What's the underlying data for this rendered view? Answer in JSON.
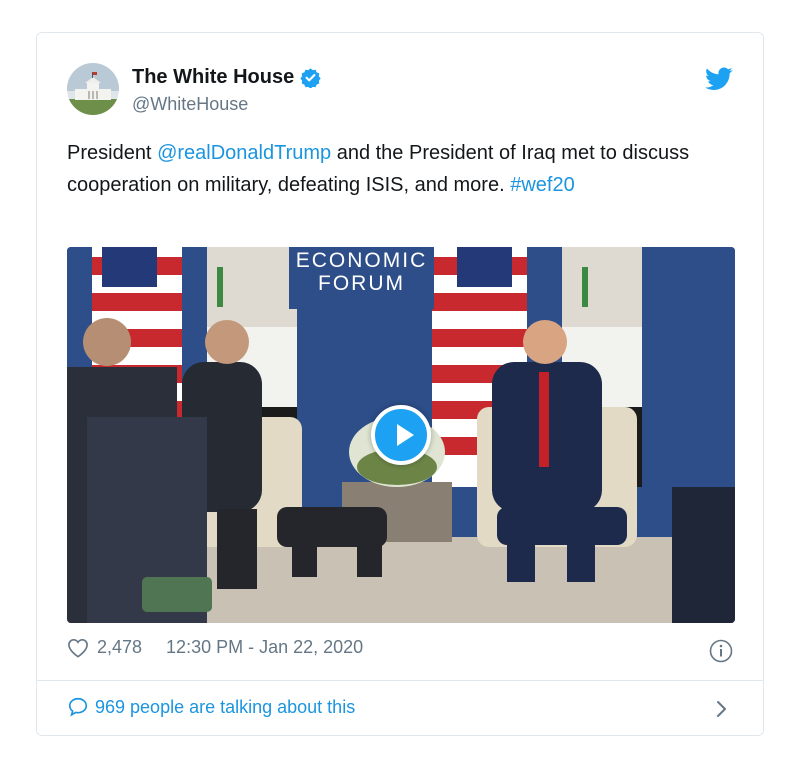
{
  "tweet": {
    "display_name": "The White House",
    "handle": "@WhiteHouse",
    "text_parts": [
      "President ",
      "@realDonaldTrump",
      " and the President of Iraq met to discuss cooperation on military, defeating ISIS, and more. ",
      "#wef20"
    ],
    "likes": "2,478",
    "timestamp": "12:30 PM - Jan 22, 2020",
    "talking": "969 people are talking about this"
  },
  "media": {
    "banner_line1": "ECONOMIC",
    "banner_line2": "FORUM"
  },
  "colors": {
    "link": "#1b95e0",
    "verified": "#1da1f2",
    "twitter_bird": "#1da1f2",
    "backdrop": "#2e4f8a"
  },
  "icons": [
    "white-house-avatar",
    "verified-badge-icon",
    "twitter-bird-icon",
    "play-icon",
    "heart-icon",
    "info-icon",
    "comment-icon",
    "chevron-right-icon"
  ]
}
